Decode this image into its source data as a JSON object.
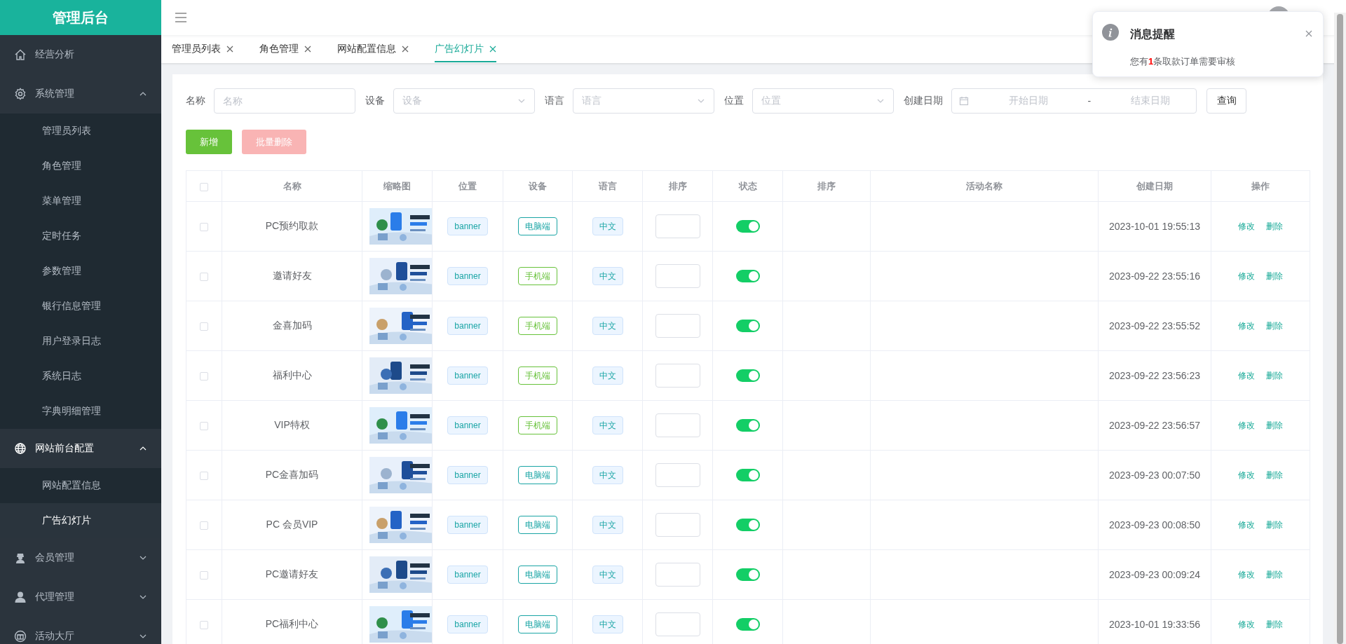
{
  "sidebar": {
    "logo": "管理后台",
    "items": [
      {
        "label": "经营分析",
        "active": false
      },
      {
        "label": "系统管理",
        "active": false,
        "expanded": true,
        "children": [
          {
            "label": "管理员列表",
            "selected": false
          },
          {
            "label": "角色管理",
            "selected": false
          },
          {
            "label": "菜单管理",
            "selected": false
          },
          {
            "label": "定时任务",
            "selected": false
          },
          {
            "label": "参数管理",
            "selected": false
          },
          {
            "label": "银行信息管理",
            "selected": false
          },
          {
            "label": "用户登录日志",
            "selected": false
          },
          {
            "label": "系统日志",
            "selected": false
          },
          {
            "label": "字典明细管理",
            "selected": false
          }
        ]
      },
      {
        "label": "网站前台配置",
        "active": true,
        "expanded": true,
        "children": [
          {
            "label": "网站配置信息",
            "selected": false
          },
          {
            "label": "广告幻灯片",
            "selected": true
          }
        ]
      },
      {
        "label": "会员管理",
        "active": false,
        "expanded": false
      },
      {
        "label": "代理管理",
        "active": false,
        "expanded": false
      },
      {
        "label": "活动大厅",
        "active": false,
        "expanded": false
      }
    ]
  },
  "tabs": [
    {
      "label": "管理员列表",
      "selected": false
    },
    {
      "label": "角色管理",
      "selected": false
    },
    {
      "label": "网站配置信息",
      "selected": false
    },
    {
      "label": "广告幻灯片",
      "selected": true
    }
  ],
  "filters": [
    {
      "kind": "input",
      "label": "名称",
      "placeholder": "名称"
    },
    {
      "kind": "select",
      "label": "设备",
      "placeholder": "设备"
    },
    {
      "kind": "select",
      "label": "语言",
      "placeholder": "语言"
    },
    {
      "kind": "select",
      "label": "位置",
      "placeholder": "位置"
    },
    {
      "kind": "daterange",
      "label": "创建日期",
      "start_placeholder": "开始日期",
      "separator": "-",
      "end_placeholder": "结束日期"
    }
  ],
  "query_button": "查询",
  "actions": [
    {
      "label": "新增",
      "kind": "add",
      "disabled": false
    },
    {
      "label": "批量删除",
      "kind": "delete",
      "disabled": true
    }
  ],
  "table": {
    "all_checked": false,
    "columns": [
      "名称",
      "缩略图",
      "位置",
      "设备",
      "语言",
      "排序",
      "状态",
      "排序",
      "活动名称",
      "创建日期",
      "操作"
    ],
    "rows": [
      {
        "checked": false,
        "name": "PC预约取款",
        "position": "banner",
        "device": {
          "label": "电脑端",
          "color": "#1aa5a5"
        },
        "language": "中文",
        "on": true,
        "created": "2023-10-01 19:55:13",
        "actions": [
          "修改",
          "删除"
        ]
      },
      {
        "checked": false,
        "name": "邀请好友",
        "position": "banner",
        "device": {
          "label": "手机端",
          "color": "#67c23a"
        },
        "language": "中文",
        "on": true,
        "created": "2023-09-22 23:55:16",
        "actions": [
          "修改",
          "删除"
        ]
      },
      {
        "checked": false,
        "name": "金喜加码",
        "position": "banner",
        "device": {
          "label": "手机端",
          "color": "#67c23a"
        },
        "language": "中文",
        "on": true,
        "created": "2023-09-22 23:55:52",
        "actions": [
          "修改",
          "删除"
        ]
      },
      {
        "checked": false,
        "name": "福利中心",
        "position": "banner",
        "device": {
          "label": "手机端",
          "color": "#67c23a"
        },
        "language": "中文",
        "on": true,
        "created": "2023-09-22 23:56:23",
        "actions": [
          "修改",
          "删除"
        ]
      },
      {
        "checked": false,
        "name": "VIP特权",
        "position": "banner",
        "device": {
          "label": "手机端",
          "color": "#67c23a"
        },
        "language": "中文",
        "on": true,
        "created": "2023-09-22 23:56:57",
        "actions": [
          "修改",
          "删除"
        ]
      },
      {
        "checked": false,
        "name": "PC金喜加码",
        "position": "banner",
        "device": {
          "label": "电脑端",
          "color": "#1aa5a5"
        },
        "language": "中文",
        "on": true,
        "created": "2023-09-23 00:07:50",
        "actions": [
          "修改",
          "删除"
        ]
      },
      {
        "checked": false,
        "name": "PC 会员VIP",
        "position": "banner",
        "device": {
          "label": "电脑端",
          "color": "#1aa5a5"
        },
        "language": "中文",
        "on": true,
        "created": "2023-09-23 00:08:50",
        "actions": [
          "修改",
          "删除"
        ]
      },
      {
        "checked": false,
        "name": "PC邀请好友",
        "position": "banner",
        "device": {
          "label": "电脑端",
          "color": "#1aa5a5"
        },
        "language": "中文",
        "on": true,
        "created": "2023-09-23 00:09:24",
        "actions": [
          "修改",
          "删除"
        ]
      },
      {
        "checked": false,
        "name": "PC福利中心",
        "position": "banner",
        "device": {
          "label": "电脑端",
          "color": "#1aa5a5"
        },
        "language": "中文",
        "on": true,
        "created": "2023-10-01 19:33:56",
        "actions": [
          "修改",
          "删除"
        ]
      }
    ]
  },
  "notification": {
    "title": "消息提醒",
    "message": "您有**1**条取款订单需要审核"
  }
}
